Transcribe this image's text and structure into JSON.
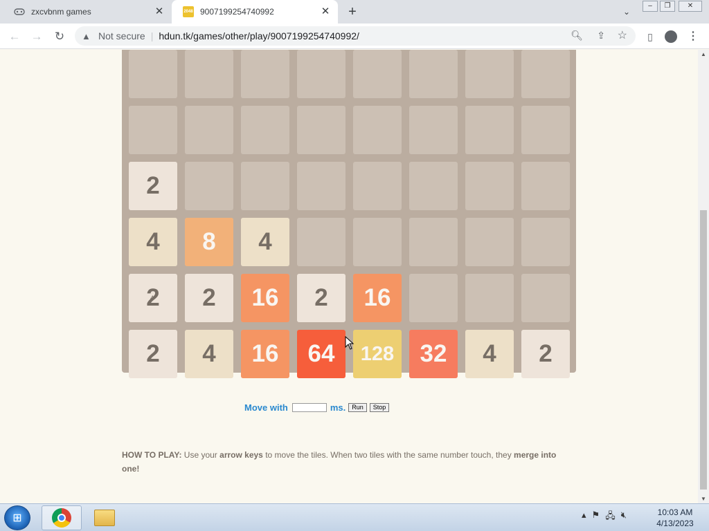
{
  "browser": {
    "tabs": [
      {
        "title": "zxcvbnm games",
        "favicon": "gamepad-icon",
        "active": false
      },
      {
        "title": "9007199254740992",
        "favicon": "2048-icon",
        "favicon_text": "2048",
        "active": true
      }
    ],
    "new_tab": "+",
    "address": {
      "security_label": "Not secure",
      "url": "hdun.tk/games/other/play/9007199254740992/"
    }
  },
  "game": {
    "board": [
      [
        0,
        0,
        0,
        0,
        0,
        0,
        0,
        0
      ],
      [
        0,
        0,
        0,
        0,
        0,
        0,
        0,
        0
      ],
      [
        2,
        0,
        0,
        0,
        0,
        0,
        0,
        0
      ],
      [
        4,
        8,
        4,
        0,
        0,
        0,
        0,
        0
      ],
      [
        2,
        2,
        16,
        2,
        16,
        0,
        0,
        0
      ],
      [
        2,
        4,
        16,
        64,
        128,
        32,
        4,
        2
      ]
    ],
    "ghost_tile_value": "4",
    "tile_colors": {
      "2": "#eee4da",
      "4": "#ede0c8",
      "8": "#f2b179",
      "16": "#f59563",
      "32": "#f67c5f",
      "64": "#f65e3b",
      "128": "#edcf72"
    },
    "controls": {
      "move_with_label": "Move with",
      "ms_value": "",
      "ms_label": "ms.",
      "run_label": "Run",
      "stop_label": "Stop"
    },
    "how_to_play": {
      "heading": "HOW TO PLAY:",
      "text1": " Use your ",
      "bold1": "arrow keys",
      "text2": " to move the tiles. When two tiles with the same number touch, they ",
      "bold2": "merge into one!"
    }
  },
  "taskbar": {
    "time": "10:03 AM",
    "date": "4/13/2023"
  }
}
